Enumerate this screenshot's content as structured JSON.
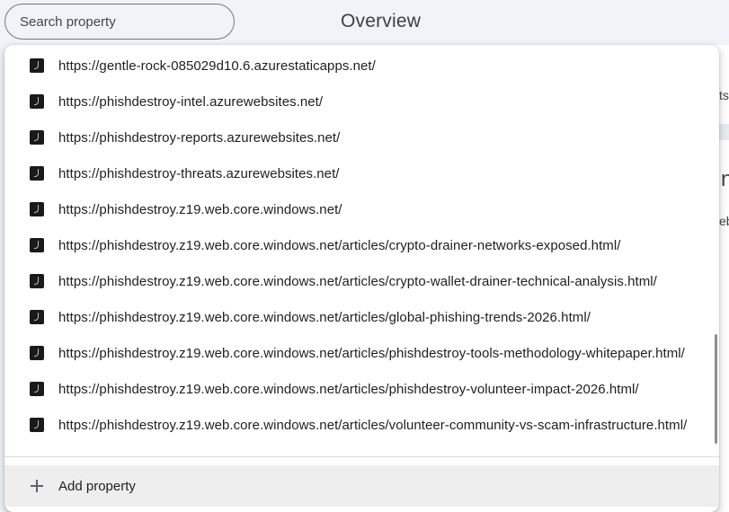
{
  "search": {
    "placeholder": "Search property"
  },
  "header": {
    "title": "Overview"
  },
  "properties": [
    "https://gentle-rock-085029d10.6.azurestaticapps.net/",
    "https://phishdestroy-intel.azurewebsites.net/",
    "https://phishdestroy-reports.azurewebsites.net/",
    "https://phishdestroy-threats.azurewebsites.net/",
    "https://phishdestroy.z19.web.core.windows.net/",
    "https://phishdestroy.z19.web.core.windows.net/articles/crypto-drainer-networks-exposed.html/",
    "https://phishdestroy.z19.web.core.windows.net/articles/crypto-wallet-drainer-technical-analysis.html/",
    "https://phishdestroy.z19.web.core.windows.net/articles/global-phishing-trends-2026.html/",
    "https://phishdestroy.z19.web.core.windows.net/articles/phishdestroy-tools-methodology-whitepaper.html/",
    "https://phishdestroy.z19.web.core.windows.net/articles/phishdestroy-volunteer-impact-2026.html/",
    "https://phishdestroy.z19.web.core.windows.net/articles/volunteer-community-vs-scam-infrastructure.html/"
  ],
  "add_property": {
    "label": "Add property",
    "icon": "plus-icon"
  },
  "background_fragments": {
    "a": "ts",
    "b": "n",
    "c": "eb"
  }
}
